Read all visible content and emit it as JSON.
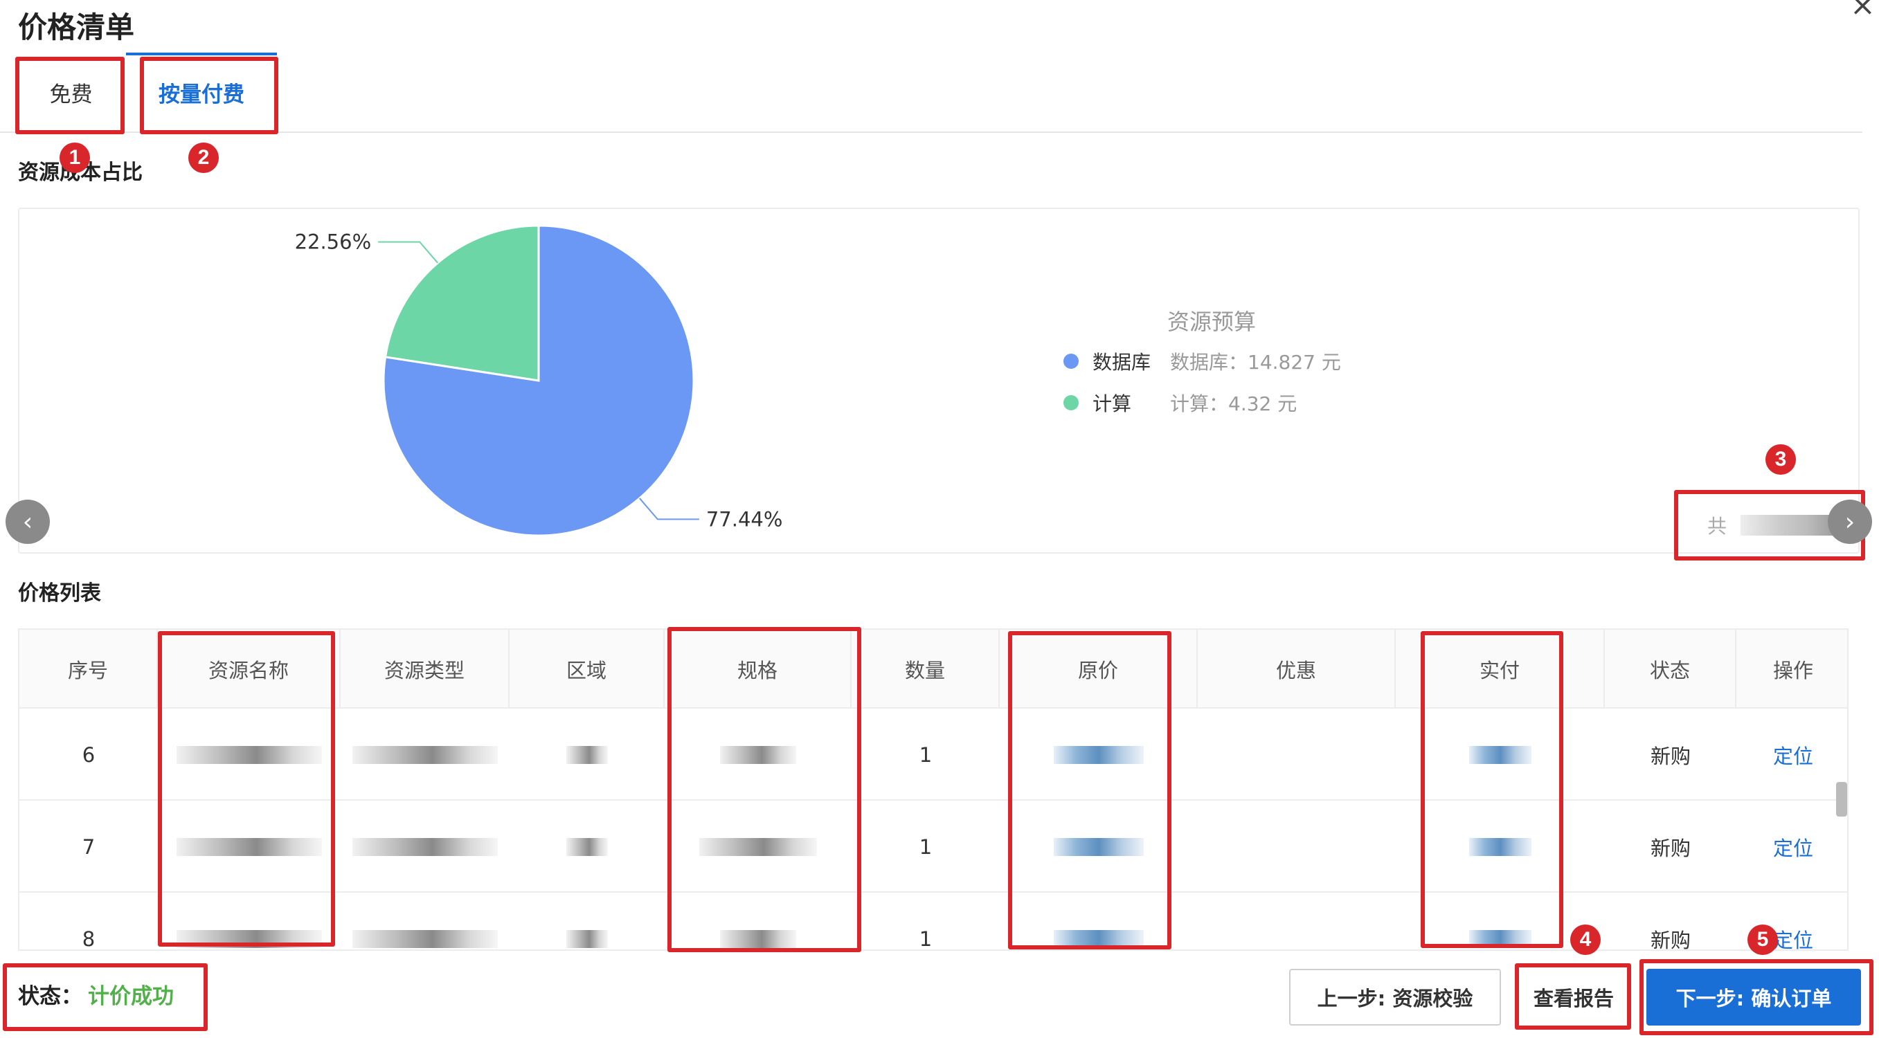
{
  "dialog": {
    "title": "价格清单",
    "close_icon": "close-icon"
  },
  "tabs": [
    {
      "label": "免费",
      "active": false
    },
    {
      "label": "按量付费",
      "active": true
    }
  ],
  "sections": {
    "cost_ratio": "资源成本占比",
    "price_list": "价格列表"
  },
  "chart_data": {
    "type": "pie",
    "title": "资源预算",
    "series": [
      {
        "name": "数据库",
        "value": 14.827,
        "percent_label": "77.44%",
        "color": "#6b98f4",
        "legend_text": "数据库：14.827 元"
      },
      {
        "name": "计算",
        "value": 4.32,
        "percent_label": "22.56%",
        "color": "#6cd6a6",
        "legend_text": "计算：4.32 元"
      }
    ]
  },
  "carousel": {
    "prev_icon": "chevron-left-icon",
    "next_icon": "chevron-right-icon",
    "pager_prefix": "共"
  },
  "table": {
    "columns": [
      "序号",
      "资源名称",
      "资源类型",
      "区域",
      "规格",
      "数量",
      "原价",
      "优惠",
      "实付",
      "状态",
      "操作"
    ],
    "rows": [
      {
        "index": "6",
        "quantity": "1",
        "status": "新购",
        "action": "定位"
      },
      {
        "index": "7",
        "quantity": "1",
        "status": "新购",
        "action": "定位"
      },
      {
        "index": "8",
        "quantity": "1",
        "status": "新购",
        "action": "定位"
      }
    ]
  },
  "footer": {
    "status_label": "状态：",
    "status_value": "计价成功",
    "prev_button": "上一步: 资源校验",
    "report_button": "查看报告",
    "next_button": "下一步: 确认订单"
  },
  "annotations": [
    "1",
    "2",
    "3",
    "4",
    "5"
  ],
  "colors": {
    "accent": "#1a6fd6",
    "success": "#52b04a",
    "highlight": "#d9262b"
  }
}
